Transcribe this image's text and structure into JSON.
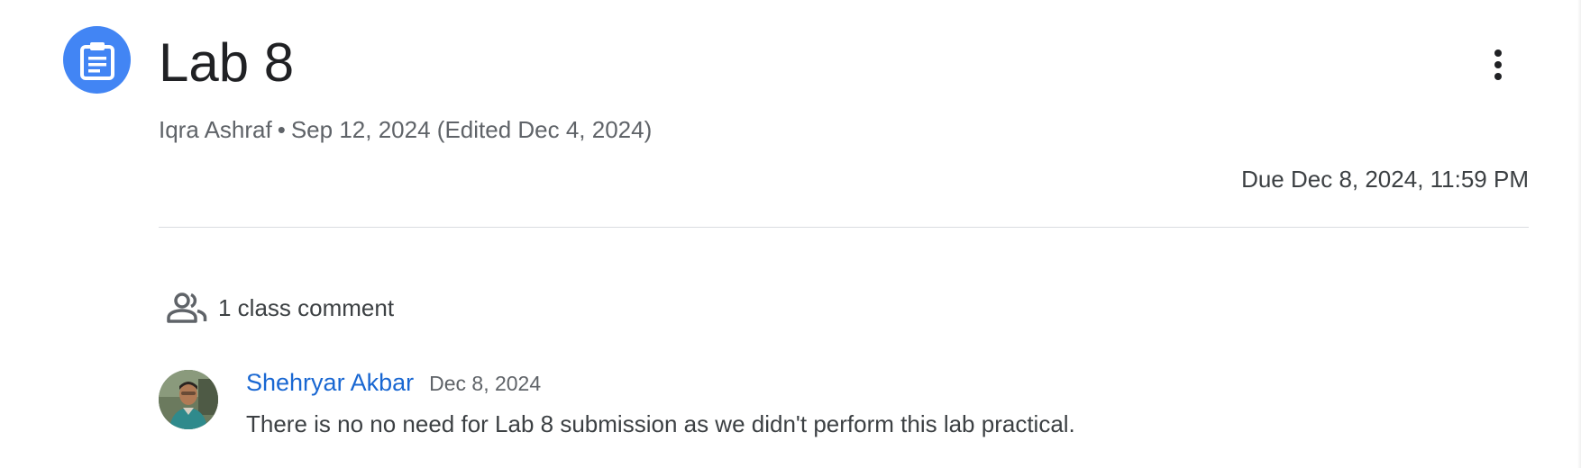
{
  "assignment": {
    "icon": "assignment-icon",
    "title": "Lab 8",
    "author": "Iqra Ashraf",
    "separator": "•",
    "posted_date": "Sep 12, 2024",
    "edited_note": "(Edited Dec 4, 2024)",
    "due": "Due Dec 8, 2024, 11:59 PM",
    "more_icon": "more-vert-icon"
  },
  "comments": {
    "header_icon": "people-icon",
    "count_label": "1 class comment",
    "items": [
      {
        "author": "Shehryar Akbar",
        "date": "Dec 8, 2024",
        "text": "There is no no need for Lab 8 submission as we didn't perform this lab practical."
      }
    ]
  },
  "colors": {
    "icon_bg": "#4285f4",
    "author_link": "#1967d2",
    "divider": "#dadce0"
  }
}
